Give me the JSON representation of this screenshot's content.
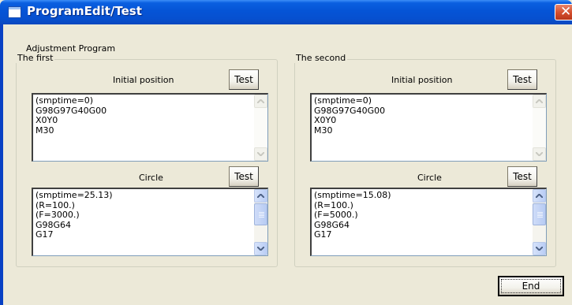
{
  "window": {
    "title": "ProgramEdit/Test"
  },
  "heading": "Adjustment Program",
  "groups": [
    {
      "legend": "The first",
      "initial": {
        "label": "Initial position",
        "test_button": "Test",
        "lines": [
          "(smptime=0)",
          "G98G97G40G00",
          "X0Y0",
          "M30"
        ]
      },
      "circle": {
        "label": "Circle",
        "test_button": "Test",
        "lines": [
          "(smptime=25.13)",
          "(R=100.)",
          "(F=3000.)",
          "G98G64",
          "G17"
        ]
      }
    },
    {
      "legend": "The second",
      "initial": {
        "label": "Initial position",
        "test_button": "Test",
        "lines": [
          "(smptime=0)",
          "G98G97G40G00",
          "X0Y0",
          "M30"
        ]
      },
      "circle": {
        "label": "Circle",
        "test_button": "Test",
        "lines": [
          "(smptime=15.08)",
          "(R=100.)",
          "(F=5000.)",
          "G98G64",
          "G17"
        ]
      }
    }
  ],
  "end_button": "End",
  "colors": {
    "titlebar": "#0554d6",
    "face": "#ece9d8",
    "close": "#d34d2c"
  }
}
